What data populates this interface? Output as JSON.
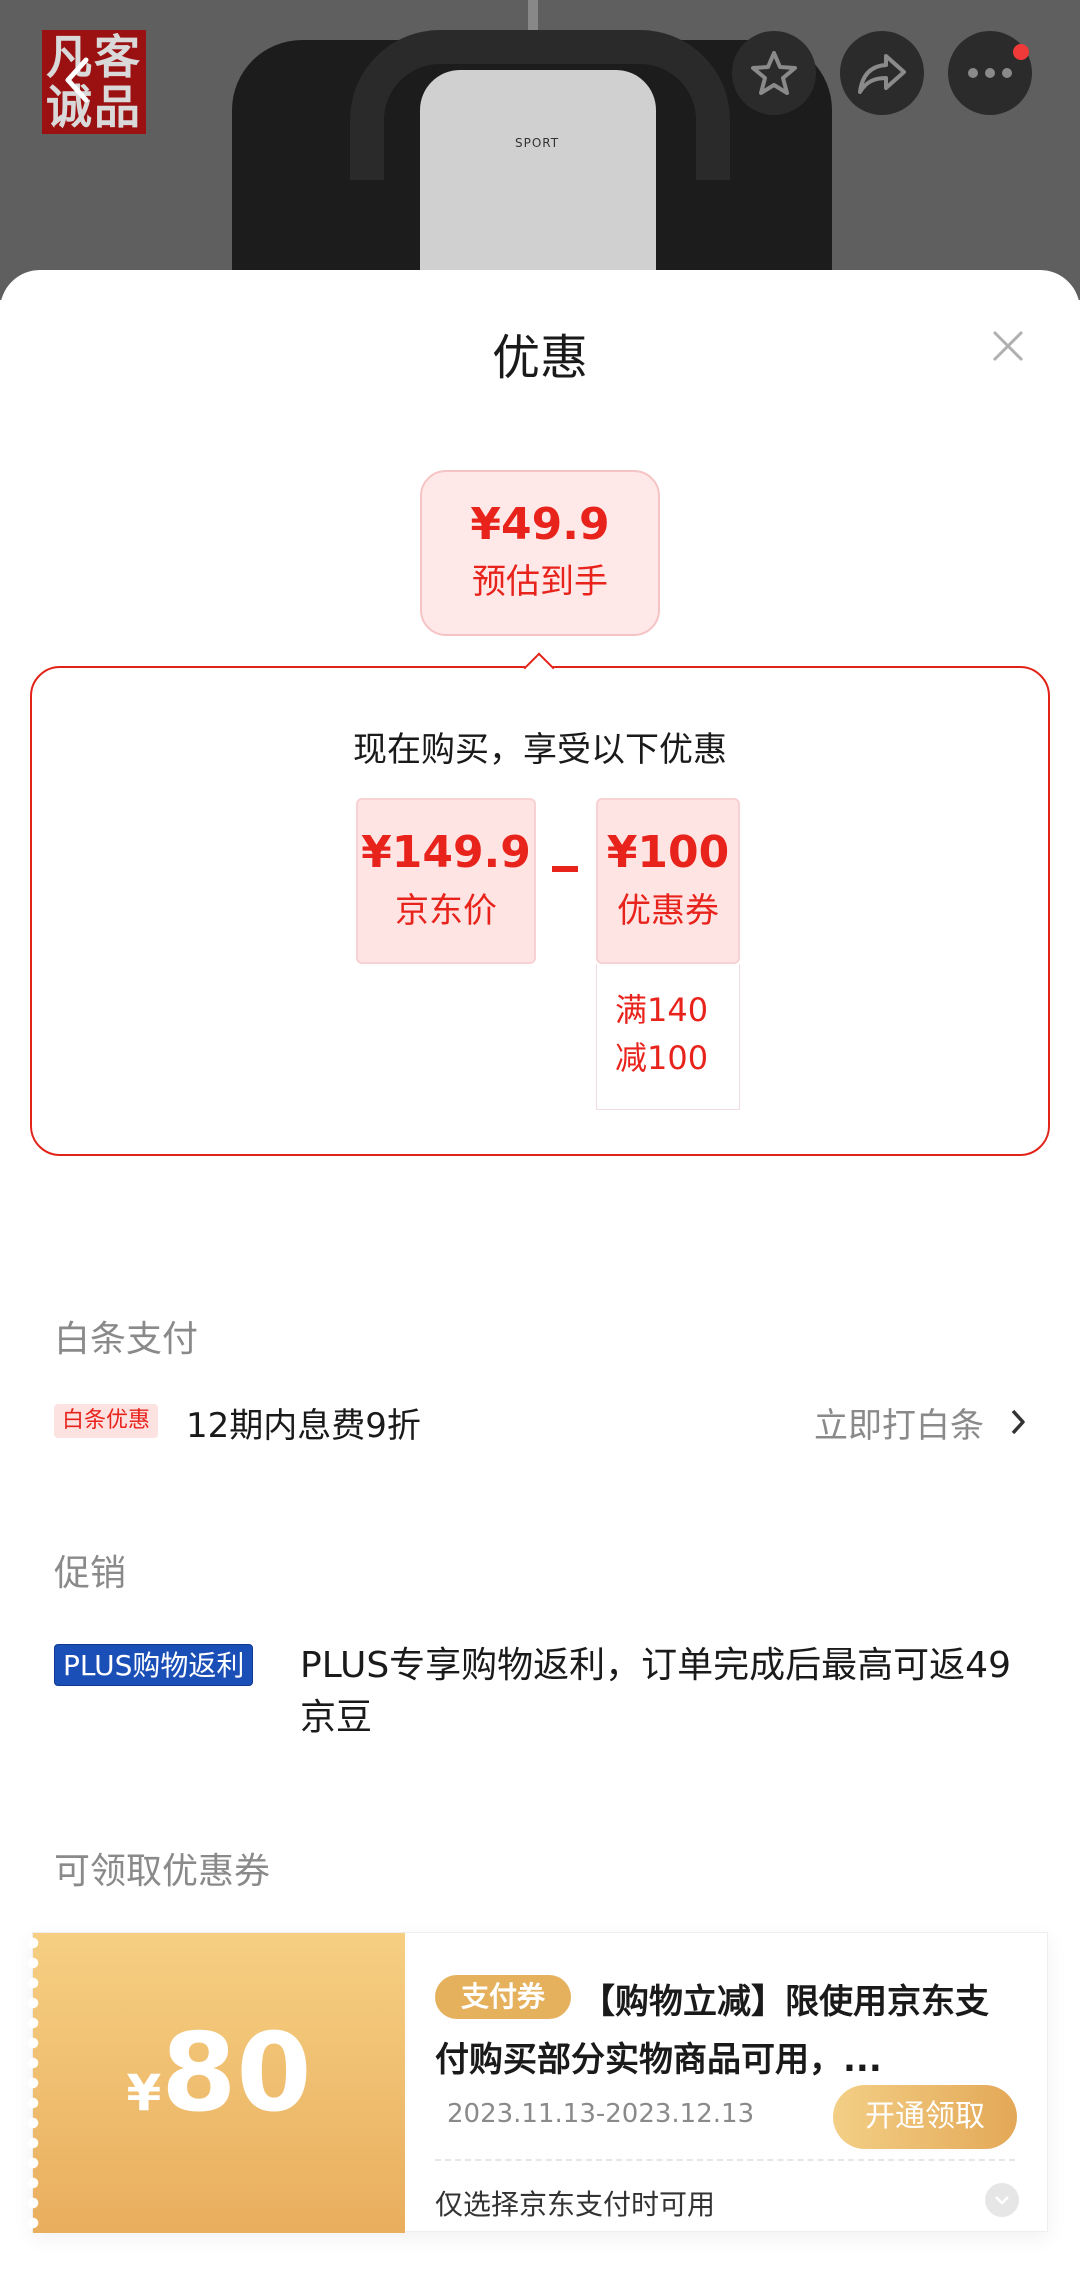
{
  "header": {
    "shop_logo_text": "凡客诚品",
    "hanger_text": "SPORT"
  },
  "sheet": {
    "title": "优惠"
  },
  "estimate": {
    "price": "¥49.9",
    "label": "预估到手"
  },
  "calculation": {
    "heading": "现在购买，享受以下优惠",
    "jd_price": {
      "value": "¥149.9",
      "label": "京东价"
    },
    "coupon": {
      "value": "¥100",
      "label": "优惠券",
      "condition_line1": "满140",
      "condition_line2": "减100"
    }
  },
  "baitiao": {
    "section_title": "白条支付",
    "tag": "白条优惠",
    "text": "12期内息费9折",
    "action": "立即打白条"
  },
  "promotion": {
    "section_title": "促销",
    "tag": "PLUS购物返利",
    "text": "PLUS专享购物返利，订单完成后最高可返49京豆"
  },
  "coupons": {
    "section_title": "可领取优惠券",
    "items": [
      {
        "currency": "¥",
        "amount": "80",
        "tag": "支付券",
        "title": "【购物立减】限使用京东支付购买部分实物商品可用，...",
        "date": "2023.11.13-2023.12.13",
        "button": "开通领取",
        "footer": "仅选择京东支付时可用"
      }
    ]
  },
  "colors": {
    "accent_red": "#e8231c",
    "gold": "#e6b15c",
    "plus_blue": "#1b4fb8"
  }
}
